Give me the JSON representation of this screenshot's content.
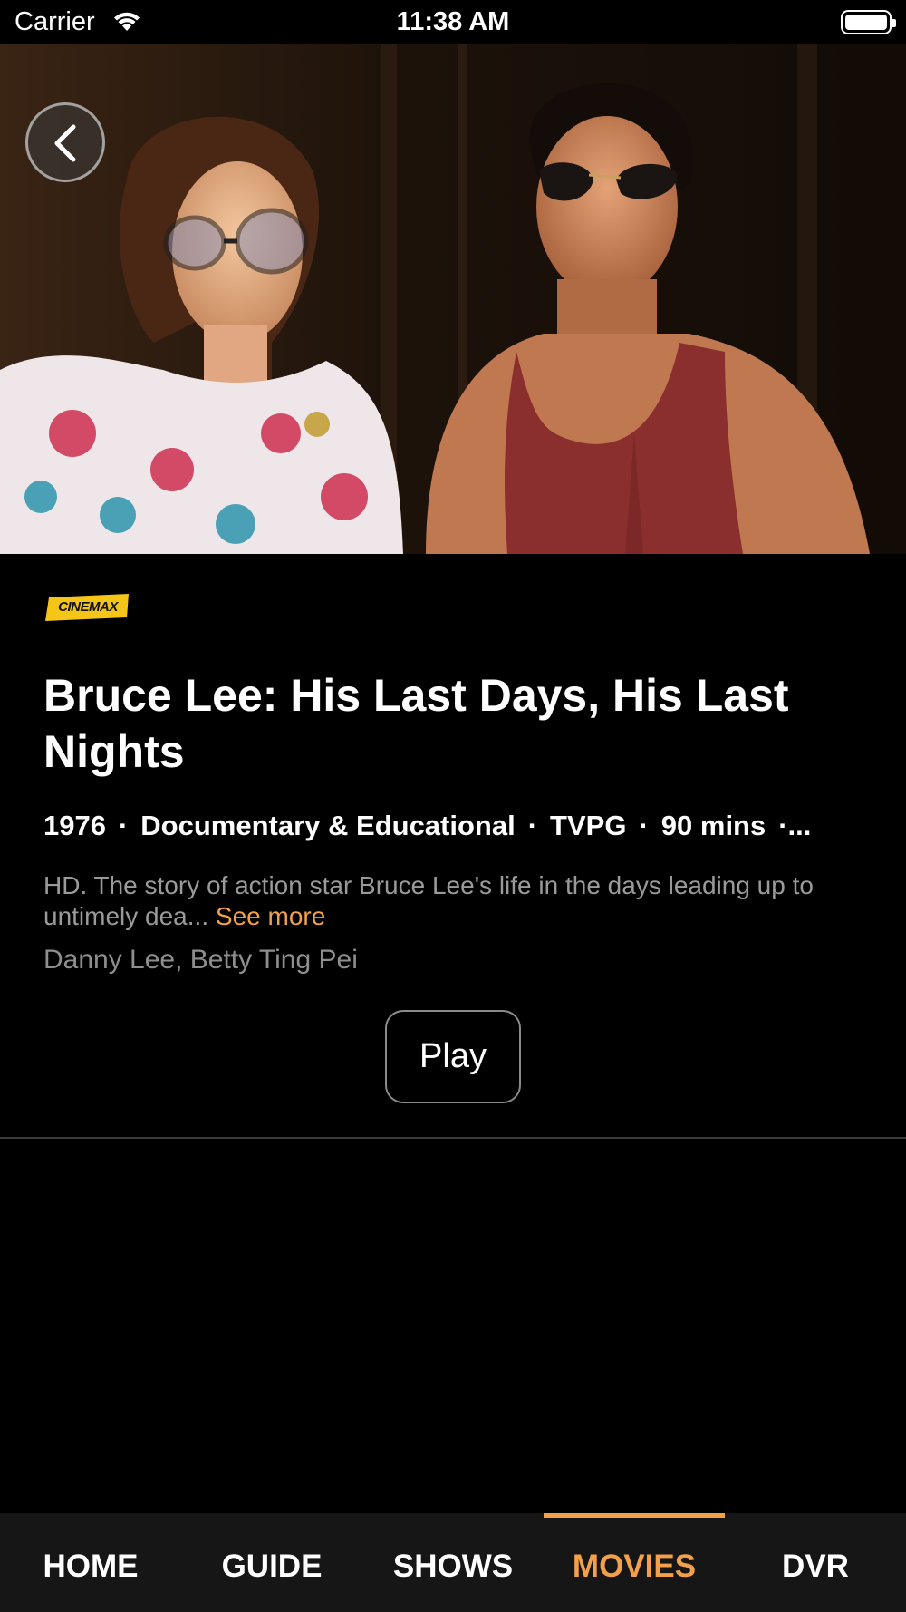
{
  "status_bar": {
    "carrier": "Carrier",
    "time": "11:38 AM",
    "wifi_icon": "wifi-icon",
    "battery_icon": "battery-icon"
  },
  "hero": {
    "back_icon": "chevron-left-icon"
  },
  "details": {
    "network_logo_text": "CINEMAX",
    "title": "Bruce Lee: His Last Days, His Last Nights",
    "meta": {
      "year": "1976",
      "genre": "Documentary & Educational",
      "rating": "TVPG",
      "duration": "90 mins",
      "overflow": "·..."
    },
    "separator": "·",
    "description": "HD. The story of action star Bruce Lee's life in the days leading up to untimely dea...",
    "see_more_label": "See more",
    "cast": "Danny Lee, Betty Ting Pei",
    "play_label": "Play"
  },
  "tab_bar": {
    "tabs": [
      {
        "label": "HOME"
      },
      {
        "label": "GUIDE"
      },
      {
        "label": "SHOWS"
      },
      {
        "label": "MOVIES"
      },
      {
        "label": "DVR"
      }
    ],
    "active_tab": "MOVIES"
  },
  "colors": {
    "accent": "#f2a04a",
    "background": "#000000",
    "tab_bar": "#161616",
    "secondary_text": "#9a9a9a",
    "network_badge": "#f5c518"
  }
}
